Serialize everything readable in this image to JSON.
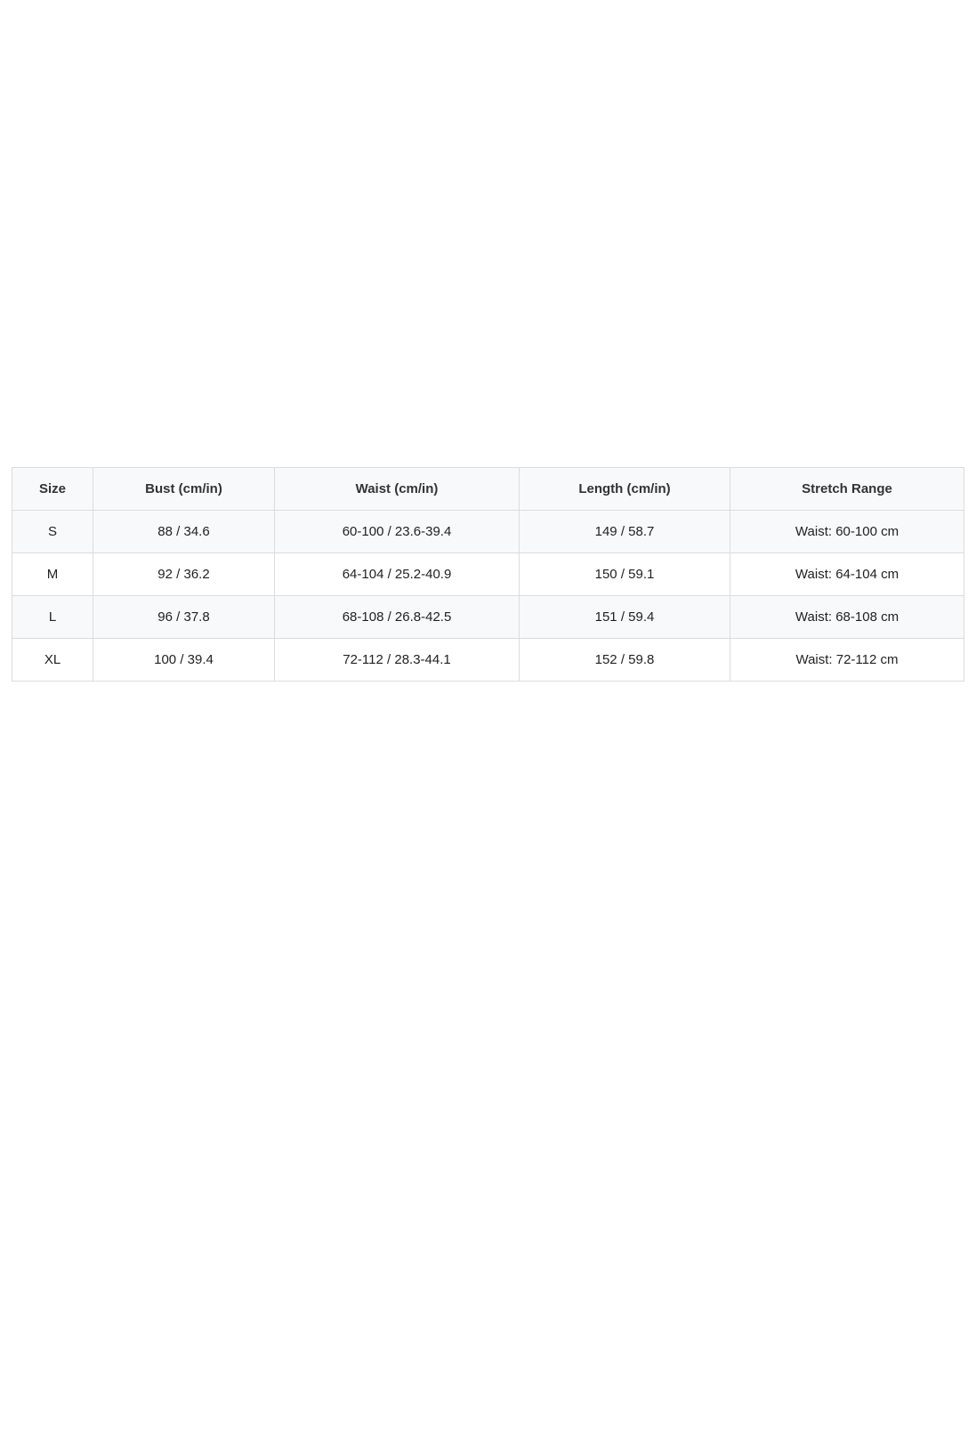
{
  "size_chart": {
    "headers": [
      "Size",
      "Bust (cm/in)",
      "Waist (cm/in)",
      "Length (cm/in)",
      "Stretch Range"
    ],
    "rows": [
      [
        "S",
        "88 / 34.6",
        "60-100 / 23.6-39.4",
        "149 / 58.7",
        "Waist: 60-100 cm"
      ],
      [
        "M",
        "92 / 36.2",
        "64-104 / 25.2-40.9",
        "150 / 59.1",
        "Waist: 64-104 cm"
      ],
      [
        "L",
        "96 / 37.8",
        "68-108 / 26.8-42.5",
        "151 / 59.4",
        "Waist: 68-108 cm"
      ],
      [
        "XL",
        "100 / 39.4",
        "72-112 / 28.3-44.1",
        "152 / 59.8",
        "Waist: 72-112 cm"
      ]
    ]
  },
  "colors": {
    "border": "#dcdcdc",
    "header_bg": "#f8f9fa",
    "alt_row_bg": "#f8f9fa",
    "text": "#222222"
  }
}
